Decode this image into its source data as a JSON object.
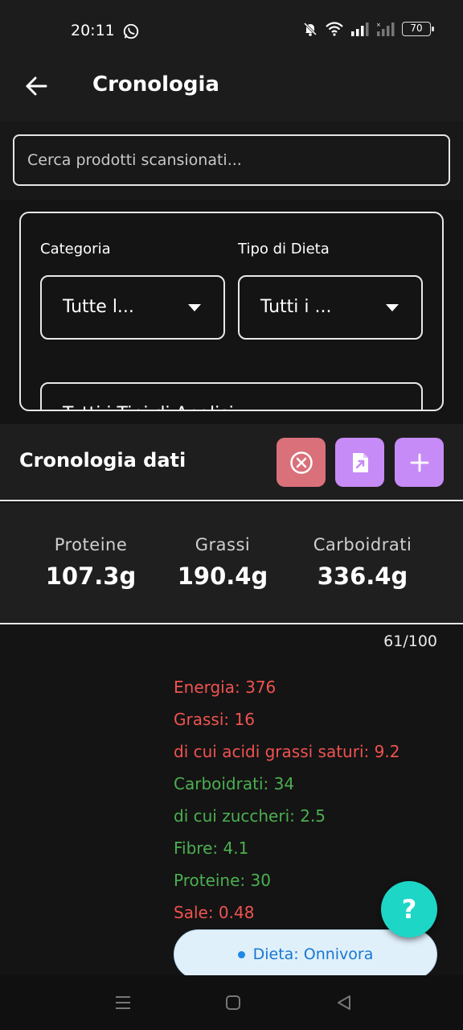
{
  "status": {
    "time": "20:11",
    "battery": "70",
    "icons": [
      "whatsapp-icon",
      "bell-off-icon",
      "wifi-icon",
      "signal-icon",
      "signal-icon-2",
      "battery-icon"
    ]
  },
  "header": {
    "title": "Cronologia",
    "back_icon": "arrow-left-icon"
  },
  "search": {
    "placeholder": "Cerca prodotti scansionati..."
  },
  "filters": {
    "category_label": "Categoria",
    "category_value": "Tutte l...",
    "diet_label": "Tipo di Dieta",
    "diet_value": "Tutti i ...",
    "analysis_value": "Tutti i Tipi di Analisi"
  },
  "history": {
    "title": "Cronologia dati",
    "actions": [
      "clear-circle-icon",
      "export-file-icon",
      "add-icon"
    ]
  },
  "macros": [
    {
      "label": "Proteine",
      "value": "107.3g"
    },
    {
      "label": "Grassi",
      "value": "190.4g"
    },
    {
      "label": "Carboidrati",
      "value": "336.4g"
    }
  ],
  "score": "61/100",
  "nutrients": [
    {
      "text": "Energia: 376",
      "status": "high"
    },
    {
      "text": "Grassi: 16",
      "status": "high"
    },
    {
      "text": "di cui acidi grassi saturi: 9.2",
      "status": "high"
    },
    {
      "text": "Carboidrati: 34",
      "status": "ok"
    },
    {
      "text": "di cui zuccheri: 2.5",
      "status": "ok"
    },
    {
      "text": "Fibre: 4.1",
      "status": "ok"
    },
    {
      "text": "Proteine: 30",
      "status": "ok"
    },
    {
      "text": "Sale: 0.48",
      "status": "high"
    }
  ],
  "diet_badge": "Dieta: Onnivora",
  "help_label": "?",
  "colors": {
    "high": "#ef5350",
    "ok": "#4caf50",
    "clear_button": "#d9707a",
    "action_button": "#c78bf7",
    "help_button": "#1ed6c6",
    "diet_badge_bg": "#e0f0fb",
    "diet_badge_text": "#1976d2"
  }
}
